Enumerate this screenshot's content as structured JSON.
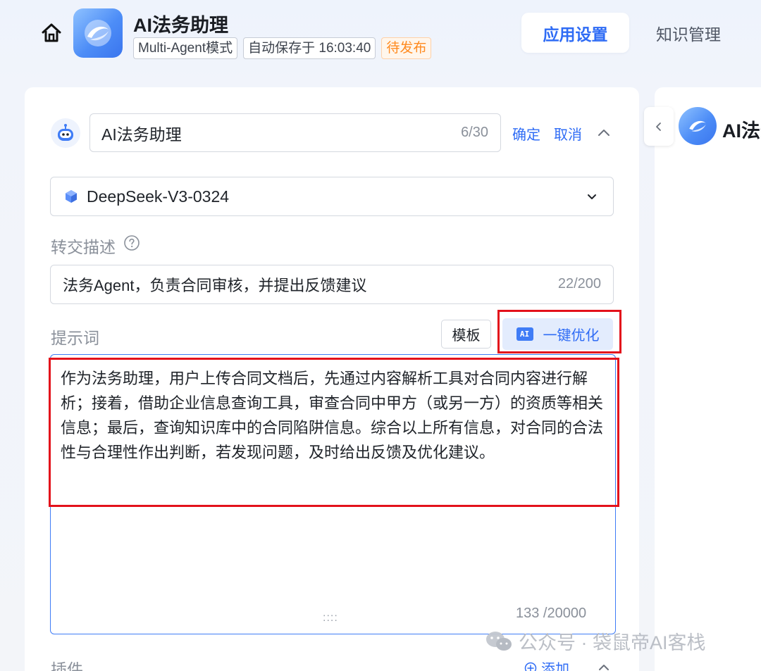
{
  "header": {
    "app_title": "AI法务助理",
    "tags": [
      "Multi-Agent模式",
      "自动保存于 16:03:40",
      "待发布"
    ],
    "tabs": [
      {
        "label": "应用设置",
        "active": true
      },
      {
        "label": "知识管理",
        "active": false
      }
    ]
  },
  "agent": {
    "name_value": "AI法务助理",
    "name_count": "6/30",
    "confirm_label": "确定",
    "cancel_label": "取消"
  },
  "model": {
    "selected": "DeepSeek-V3-0324"
  },
  "handoff": {
    "label": "转交描述",
    "value": "法务Agent，负责合同审核，并提出反馈建议",
    "count": "22/200"
  },
  "prompt": {
    "label": "提示词",
    "template_label": "模板",
    "ai_badge": "AI",
    "optimize_label": "一键优化",
    "text": "作为法务助理，用户上传合同文档后，先通过内容解析工具对合同内容进行解析；接着，借助企业信息查询工具，审查合同中甲方（或另一方）的资质等相关信息；最后，查询知识库中的合同陷阱信息。综合以上所有信息，对合同的合法性与合理性作出判断，若发现问题，及时给出反馈及优化建议。",
    "drag_handle": "::::",
    "count": "133 /20000"
  },
  "plugins": {
    "label": "插件",
    "add_label": "添加"
  },
  "preview": {
    "title": "AI法务"
  },
  "watermark": "公众号 · 袋鼠帝AI客栈",
  "colors": {
    "accent": "#2f6cf5",
    "highlight_box": "#e3111b",
    "pending_tag": "#ff8a1f"
  }
}
